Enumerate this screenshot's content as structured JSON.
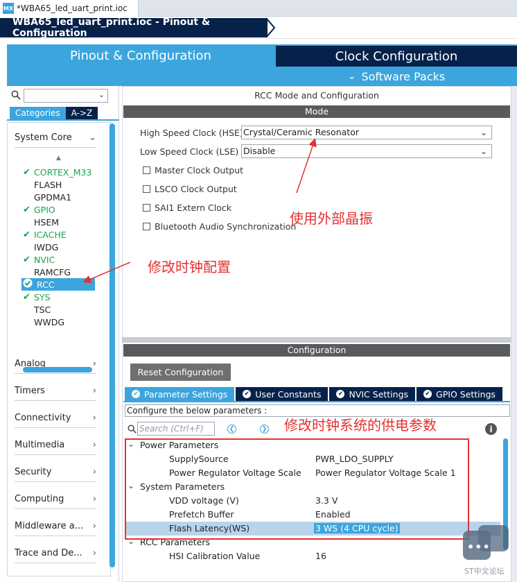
{
  "file_tab": {
    "icon": "MX",
    "label": "*WBA65_led_uart_print.ioc"
  },
  "breadcrumb": {
    "label": "WBA65_led_uart_print.ioc - Pinout & Configuration"
  },
  "main_tabs": {
    "pinout": "Pinout & Configuration",
    "clock": "Clock Configuration",
    "packs": "Software Packs"
  },
  "left": {
    "categories_tab": "Categories",
    "az_tab": "A->Z",
    "system_core": "System Core",
    "peripherals": [
      {
        "label": "CORTEX_M33",
        "state": "on"
      },
      {
        "label": "FLASH",
        "state": "off"
      },
      {
        "label": "GPDMA1",
        "state": "off"
      },
      {
        "label": "GPIO",
        "state": "on"
      },
      {
        "label": "HSEM",
        "state": "off"
      },
      {
        "label": "ICACHE",
        "state": "on"
      },
      {
        "label": "IWDG",
        "state": "off"
      },
      {
        "label": "NVIC",
        "state": "on"
      },
      {
        "label": "RAMCFG",
        "state": "off"
      },
      {
        "label": "RCC",
        "state": "selected"
      },
      {
        "label": "SYS",
        "state": "on"
      },
      {
        "label": "TSC",
        "state": "off"
      },
      {
        "label": "WWDG",
        "state": "off"
      }
    ],
    "groups": [
      "Analog",
      "Timers",
      "Connectivity",
      "Multimedia",
      "Security",
      "Computing",
      "Middleware a...",
      "Trace and De..."
    ]
  },
  "mode": {
    "title": "RCC Mode and Configuration",
    "bar": "Mode",
    "hse_label": "High Speed Clock (HSE)",
    "hse_value": "Crystal/Ceramic Resonator",
    "lse_label": "Low Speed Clock (LSE)",
    "lse_value": "Disable",
    "checkboxes": [
      "Master Clock Output",
      "LSCO Clock Output",
      "SAI1 Extern Clock",
      "Bluetooth Audio Synchronization"
    ]
  },
  "config": {
    "bar": "Configuration",
    "reset_button": "Reset Configuration",
    "tabs": [
      "Parameter Settings",
      "User Constants",
      "NVIC Settings",
      "GPIO Settings"
    ],
    "note": "Configure the below parameters :",
    "search_placeholder": "Search (Ctrl+F)",
    "groups": [
      {
        "title": "Power Parameters",
        "rows": [
          {
            "k": "SupplySource",
            "v": "PWR_LDO_SUPPLY"
          },
          {
            "k": "Power Regulator Voltage Scale",
            "v": "Power Regulator Voltage Scale 1"
          }
        ]
      },
      {
        "title": "System Parameters",
        "rows": [
          {
            "k": "VDD voltage (V)",
            "v": "3.3 V"
          },
          {
            "k": "Prefetch Buffer",
            "v": "Enabled"
          },
          {
            "k": "Flash Latency(WS)",
            "v": "3 WS (4 CPU cycle)"
          }
        ]
      },
      {
        "title": "RCC Parameters",
        "rows": [
          {
            "k": "HSI Calibration Value",
            "v": "16"
          }
        ]
      }
    ]
  },
  "annotations": {
    "hse": "使用外部晶振",
    "rcc": "修改时钟配置",
    "power": "修改时钟系统的供电参数"
  },
  "watermark": "ST中文论坛",
  "colors": {
    "accent": "#3ca5dd",
    "navy": "#06224a",
    "annotation": "#e53030",
    "enabled_green": "#1aa34a"
  }
}
